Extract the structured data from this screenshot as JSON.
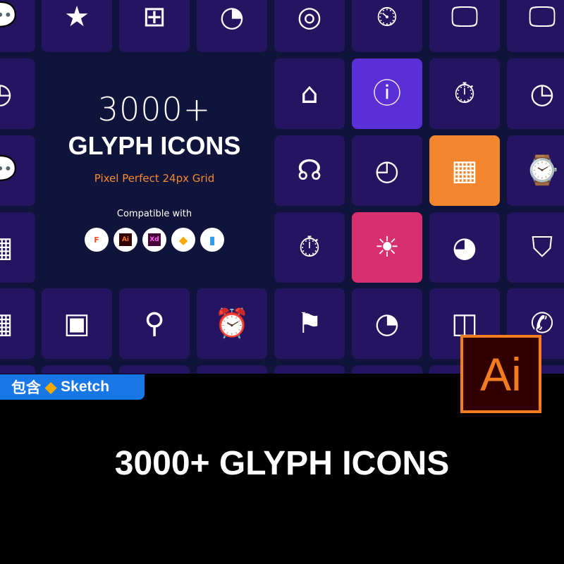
{
  "hero": {
    "count": "3000+",
    "title": "GLYPH ICONS",
    "subtitle": "Pixel Perfect 24px Grid",
    "compatible_label": "Compatible with",
    "apps": [
      {
        "name": "figma",
        "label": "F"
      },
      {
        "name": "illustrator",
        "label": "Ai"
      },
      {
        "name": "xd",
        "label": "Xd"
      },
      {
        "name": "sketch",
        "label": "◆"
      },
      {
        "name": "iconjar",
        "label": "▮"
      }
    ]
  },
  "colors": {
    "background": "#11143a",
    "tile": "#25145f",
    "purple": "#5b2fd6",
    "orange": "#f4862f",
    "pink": "#d8306f",
    "accent_text": "#f08a34"
  },
  "tiles": [
    {
      "row": 0,
      "col": 0,
      "icon": "chat-icon"
    },
    {
      "row": 0,
      "col": 1,
      "icon": "badge-stars-icon"
    },
    {
      "row": 0,
      "col": 2,
      "icon": "network-icon"
    },
    {
      "row": 0,
      "col": 3,
      "icon": "timer-icon"
    },
    {
      "row": 0,
      "col": 4,
      "icon": "target-icon"
    },
    {
      "row": 0,
      "col": 5,
      "icon": "clock-tag-icon"
    },
    {
      "row": 0,
      "col": 6,
      "icon": "monitor-wifi-icon"
    },
    {
      "row": 0,
      "col": 7,
      "icon": "monitor-wifi-icon"
    },
    {
      "row": 1,
      "col": 0,
      "icon": "chat-clock-icon"
    },
    {
      "row": 1,
      "col": 4,
      "icon": "tombstone-icon"
    },
    {
      "row": 1,
      "col": 5,
      "icon": "info-chat-icon",
      "color": "purple"
    },
    {
      "row": 1,
      "col": 6,
      "icon": "stopwatch-icon"
    },
    {
      "row": 1,
      "col": 7,
      "icon": "clock-icon"
    },
    {
      "row": 2,
      "col": 0,
      "icon": "chat-icon"
    },
    {
      "row": 2,
      "col": 4,
      "icon": "headset-icon"
    },
    {
      "row": 2,
      "col": 5,
      "icon": "clock-dome-icon"
    },
    {
      "row": 2,
      "col": 6,
      "icon": "calendar-x-icon",
      "color": "orange"
    },
    {
      "row": 2,
      "col": 7,
      "icon": "smartwatch-icon"
    },
    {
      "row": 3,
      "col": 0,
      "icon": "calendar-icon"
    },
    {
      "row": 3,
      "col": 4,
      "icon": "stopwatch-icon"
    },
    {
      "row": 3,
      "col": 5,
      "icon": "sun-icon",
      "color": "pink"
    },
    {
      "row": 3,
      "col": 6,
      "icon": "timer-refresh-icon"
    },
    {
      "row": 3,
      "col": 7,
      "icon": "shield-clock-icon"
    },
    {
      "row": 4,
      "col": 0,
      "icon": "calendar-clock-icon"
    },
    {
      "row": 4,
      "col": 1,
      "icon": "clock-frame-icon"
    },
    {
      "row": 4,
      "col": 2,
      "icon": "clock-search-icon"
    },
    {
      "row": 4,
      "col": 3,
      "icon": "alarm-clock-icon"
    },
    {
      "row": 4,
      "col": 4,
      "icon": "location-star-icon"
    },
    {
      "row": 4,
      "col": 5,
      "icon": "timer-icon"
    },
    {
      "row": 4,
      "col": 6,
      "icon": "clock-box-icon"
    },
    {
      "row": 4,
      "col": 7,
      "icon": "phone-x-icon"
    },
    {
      "row": 5,
      "col": 0,
      "icon": "blank"
    },
    {
      "row": 5,
      "col": 1,
      "icon": "blank"
    },
    {
      "row": 5,
      "col": 2,
      "icon": "blank"
    },
    {
      "row": 5,
      "col": 3,
      "icon": "blank"
    },
    {
      "row": 5,
      "col": 4,
      "icon": "blank"
    },
    {
      "row": 5,
      "col": 5,
      "icon": "blank"
    },
    {
      "row": 5,
      "col": 6,
      "icon": "blank"
    },
    {
      "row": 5,
      "col": 7,
      "icon": "blank"
    }
  ],
  "badge": {
    "label_cn": "包含",
    "label": "Sketch"
  },
  "ai_logo": "Ai",
  "footer": {
    "title": "3000+ GLYPH ICONS"
  }
}
